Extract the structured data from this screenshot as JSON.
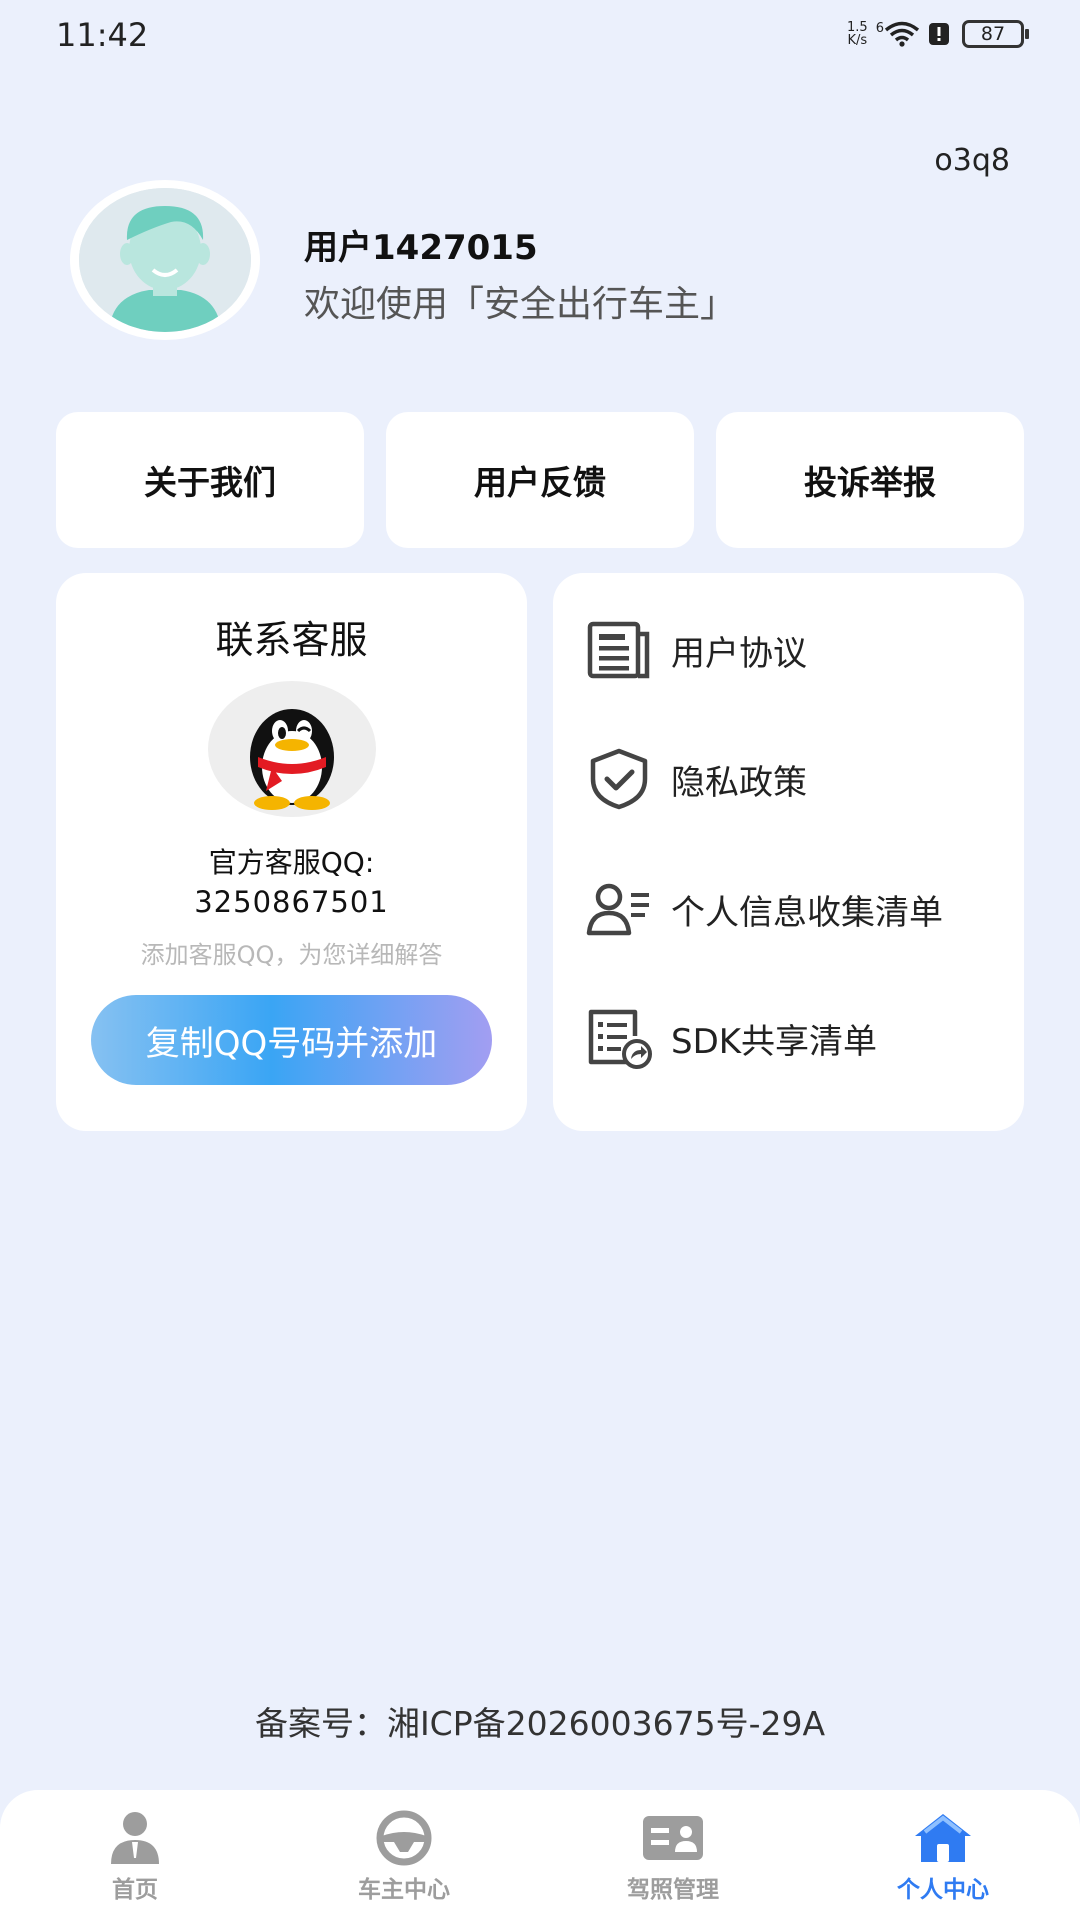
{
  "status_bar": {
    "time": "11:42",
    "net_speed_value": "1.5",
    "net_speed_unit": "K/s",
    "signal_label": "6",
    "battery": "87"
  },
  "header": {
    "code": "o3q8",
    "username": "用户1427015",
    "welcome": "欢迎使用「安全出行车主」"
  },
  "quick_actions": [
    {
      "label": "关于我们"
    },
    {
      "label": "用户反馈"
    },
    {
      "label": "投诉举报"
    }
  ],
  "customer_service": {
    "title": "联系客服",
    "line1": "官方客服QQ:",
    "qq_number": "3250867501",
    "hint": "添加客服QQ，为您详细解答",
    "button": "复制QQ号码并添加"
  },
  "menu": [
    {
      "label": "用户协议",
      "icon": "document-icon"
    },
    {
      "label": "隐私政策",
      "icon": "shield-check-icon"
    },
    {
      "label": "个人信息收集清单",
      "icon": "user-list-icon"
    },
    {
      "label": "SDK共享清单",
      "icon": "share-list-icon"
    }
  ],
  "footer": {
    "icp": "备案号：湘ICP备2026003675号-29A"
  },
  "tabs": [
    {
      "label": "首页",
      "icon": "person-icon",
      "active": false
    },
    {
      "label": "车主中心",
      "icon": "steering-wheel-icon",
      "active": false
    },
    {
      "label": "驾照管理",
      "icon": "license-card-icon",
      "active": false
    },
    {
      "label": "个人中心",
      "icon": "home-icon",
      "active": true
    }
  ],
  "colors": {
    "background": "#ebf0fc",
    "active_tab": "#2f7bf2",
    "inactive_tab": "#9d9d9d",
    "avatar_teal": "#6fcfbf"
  }
}
